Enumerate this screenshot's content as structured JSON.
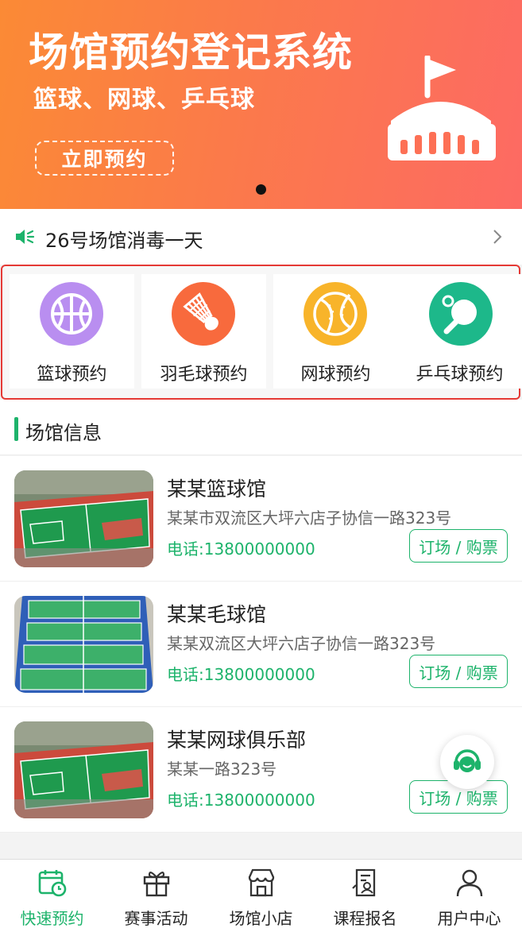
{
  "banner": {
    "title": "场馆预约登记系统",
    "subtitle": "篮球、网球、乒乓球",
    "button_label": "立即预约",
    "gradient_start": "#fb8a35",
    "gradient_end": "#fd6a63",
    "icon": "stadium-icon"
  },
  "notice": {
    "icon": "speaker-icon",
    "text": "26号场馆消毒一天"
  },
  "categories": [
    {
      "label": "篮球预约",
      "icon": "basketball-icon",
      "color": "#b98ef0"
    },
    {
      "label": "羽毛球预约",
      "icon": "shuttlecock-icon",
      "color": "#f86a3d"
    },
    {
      "label": "网球预约",
      "icon": "tennis-ball-icon",
      "color": "#f8b42a"
    },
    {
      "label": "乒乓球预约",
      "icon": "ping-pong-icon",
      "color": "#1db88a"
    }
  ],
  "section": {
    "title": "场馆信息"
  },
  "venues": [
    {
      "name": "某某篮球馆",
      "address": "某某市双流区大坪六店子协信一路323号",
      "phone": "电话:13800000000",
      "button": "订场 / 购票"
    },
    {
      "name": "某某毛球馆",
      "address": "某某双流区大坪六店子协信一路323号",
      "phone": "电话:13800000000",
      "button": "订场 / 购票"
    },
    {
      "name": "某某网球俱乐部",
      "address": "某某一路323号",
      "phone": "电话:13800000000",
      "button": "订场 / 购票"
    }
  ],
  "accent_color": "#1db36b",
  "tabs": [
    {
      "label": "快速预约",
      "icon": "calendar-clock-icon",
      "active": true
    },
    {
      "label": "赛事活动",
      "icon": "gift-icon",
      "active": false
    },
    {
      "label": "场馆小店",
      "icon": "shop-icon",
      "active": false
    },
    {
      "label": "课程报名",
      "icon": "signup-form-icon",
      "active": false
    },
    {
      "label": "用户中心",
      "icon": "user-icon",
      "active": false
    }
  ],
  "floating": {
    "icon": "customer-service-icon"
  }
}
